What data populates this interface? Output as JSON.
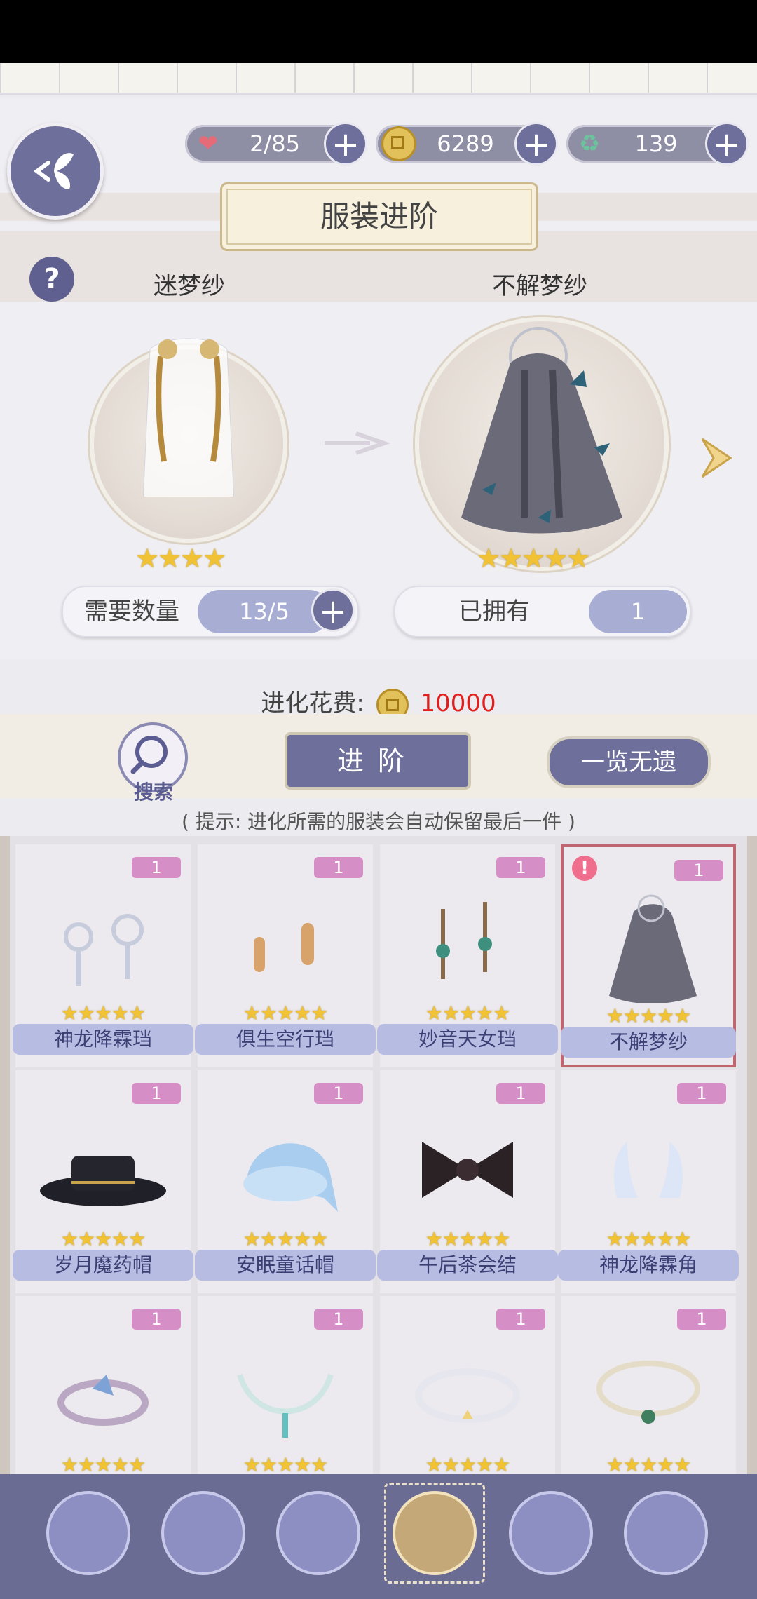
{
  "resources": [
    {
      "id": "hearts",
      "icon": "heart-icon",
      "value": "2/85",
      "color": "#e66b79"
    },
    {
      "id": "coins",
      "icon": "coin-icon",
      "value": "6289",
      "color": "#e2c15a"
    },
    {
      "id": "gems",
      "icon": "jade-icon",
      "value": "139",
      "color": "#6cc39c"
    }
  ],
  "title": "服装进阶",
  "source_item": {
    "name": "迷梦纱",
    "stars": "★★★★",
    "qty_label": "需要数量",
    "qty_value": "13/5"
  },
  "target_item": {
    "name": "不解梦纱",
    "stars": "★★★★★",
    "owned_label": "已拥有",
    "owned_value": "1"
  },
  "cost": {
    "label": "进化花费:",
    "value": "10000"
  },
  "buttons": {
    "search": "搜索",
    "evolve": "进阶",
    "overview": "一览无遗"
  },
  "hint": "( 提示: 进化所需的服装会自动保留最后一件 )",
  "grid": [
    {
      "name": "神龙降霖珰",
      "count": "1",
      "stars": "★★★★★",
      "icon": "earring-icon"
    },
    {
      "name": "俱生空行珰",
      "count": "1",
      "stars": "★★★★★",
      "icon": "earring-icon"
    },
    {
      "name": "妙音天女珰",
      "count": "1",
      "stars": "★★★★★",
      "icon": "earring-icon"
    },
    {
      "name": "不解梦纱",
      "count": "1",
      "stars": "★★★★★",
      "icon": "veil-icon",
      "selected": true
    },
    {
      "name": "岁月魔药帽",
      "count": "1",
      "stars": "★★★★★",
      "icon": "hat-icon"
    },
    {
      "name": "安眠童话帽",
      "count": "1",
      "stars": "★★★★★",
      "icon": "nightcap-icon"
    },
    {
      "name": "午后茶会结",
      "count": "1",
      "stars": "★★★★★",
      "icon": "bow-icon"
    },
    {
      "name": "神龙降霖角",
      "count": "1",
      "stars": "★★★★★",
      "icon": "horn-icon"
    },
    {
      "name": "",
      "count": "1",
      "stars": "★★★★★",
      "icon": "bracelet-icon"
    },
    {
      "name": "",
      "count": "1",
      "stars": "★★★★★",
      "icon": "necklace-icon"
    },
    {
      "name": "",
      "count": "1",
      "stars": "★★★★★",
      "icon": "necklace-icon"
    },
    {
      "name": "",
      "count": "1",
      "stars": "★★★★★",
      "icon": "necklace-icon"
    }
  ],
  "tabs": [
    "hair-tab-icon",
    "dress-tab-icon",
    "shoes-tab-icon",
    "accessory-tab-icon",
    "bell-tab-icon",
    "bottle-tab-icon"
  ],
  "accent": "#6e6f9b"
}
